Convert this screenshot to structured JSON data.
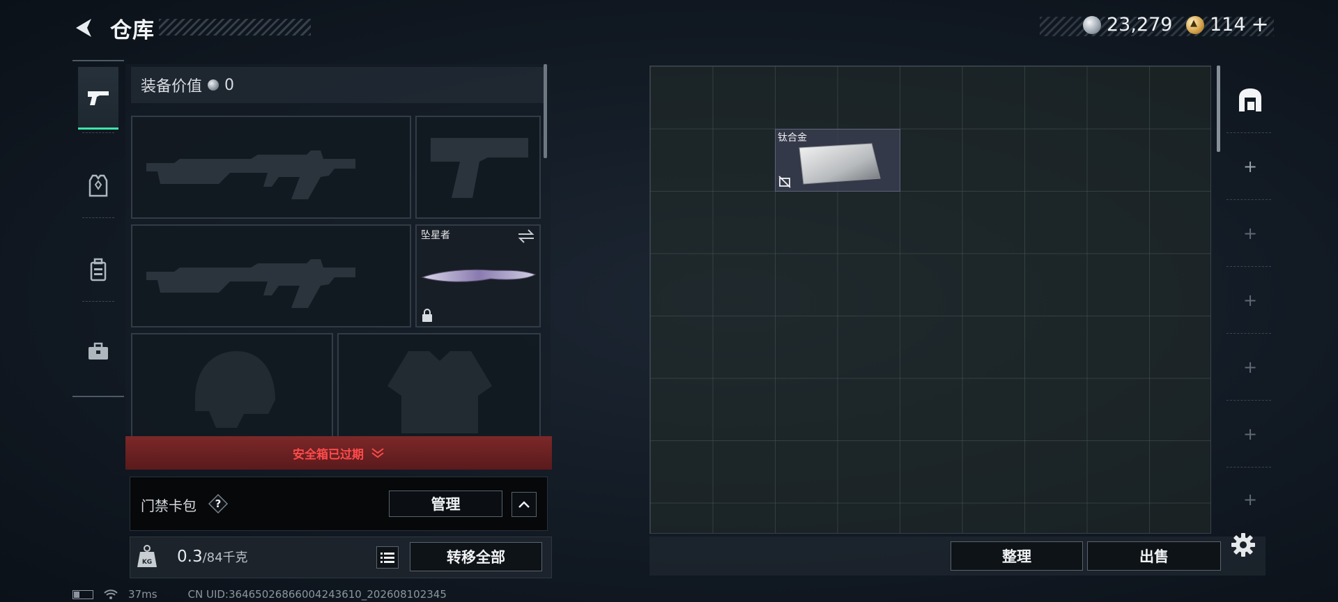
{
  "header": {
    "title": "仓库",
    "currency_silver": "23,279",
    "currency_gold": "114",
    "add_symbol": "+"
  },
  "equipment": {
    "value_label": "装备价值",
    "value": "0",
    "melee_name": "坠星者"
  },
  "safebox": {
    "text": "安全箱已过期"
  },
  "keycard": {
    "label": "门禁卡包",
    "help": "?",
    "manage_label": "管理"
  },
  "weight": {
    "current": "0.3",
    "max": "/84千克"
  },
  "transfer_all_label": "转移全部",
  "status_bar": {
    "ping": "37ms",
    "uid": "CN UID:3646502686600424361​0_202608102345"
  },
  "stash": {
    "item_name": "钛合金",
    "sort_label": "整理",
    "sell_label": "出售",
    "add_slot_symbol": "+"
  },
  "colors": {
    "accent": "#3be6a7",
    "warning_red": "#ff4a4a"
  }
}
